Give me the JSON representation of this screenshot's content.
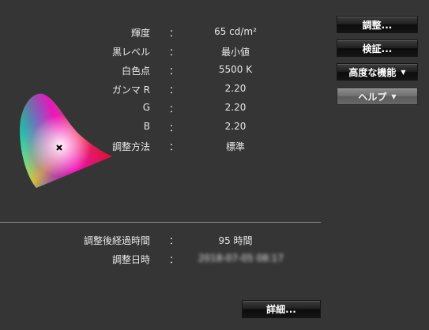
{
  "info": {
    "luminance": {
      "label": "輝度",
      "value": "65 cd/m²"
    },
    "black_level": {
      "label": "黒レベル",
      "value": "最小値"
    },
    "white_point": {
      "label": "白色点",
      "value": "5500 K"
    },
    "gamma_r": {
      "label": "ガンマ R",
      "value": "2.20"
    },
    "gamma_g": {
      "label": "G",
      "value": "2.20"
    },
    "gamma_b": {
      "label": "B",
      "value": "2.20"
    },
    "method": {
      "label": "調整方法",
      "value": "標準"
    },
    "elapsed": {
      "label": "調整後経過時間",
      "value": "95 時間"
    },
    "date": {
      "label": "調整日時",
      "value": "2018-07-05 08:17"
    }
  },
  "colon": "：",
  "buttons": {
    "adjust": "調整...",
    "verify": "検証...",
    "advanced": "高度な機能",
    "help": "ヘルプ",
    "details": "詳細..."
  },
  "caret": "▼",
  "colors": {
    "background": "#353535",
    "text": "#e8e8e8",
    "divider": "#8f8f8f"
  },
  "icons": {
    "gamut": "color-gamut-triangle-icon",
    "white_point_marker": "cross-marker-icon"
  }
}
